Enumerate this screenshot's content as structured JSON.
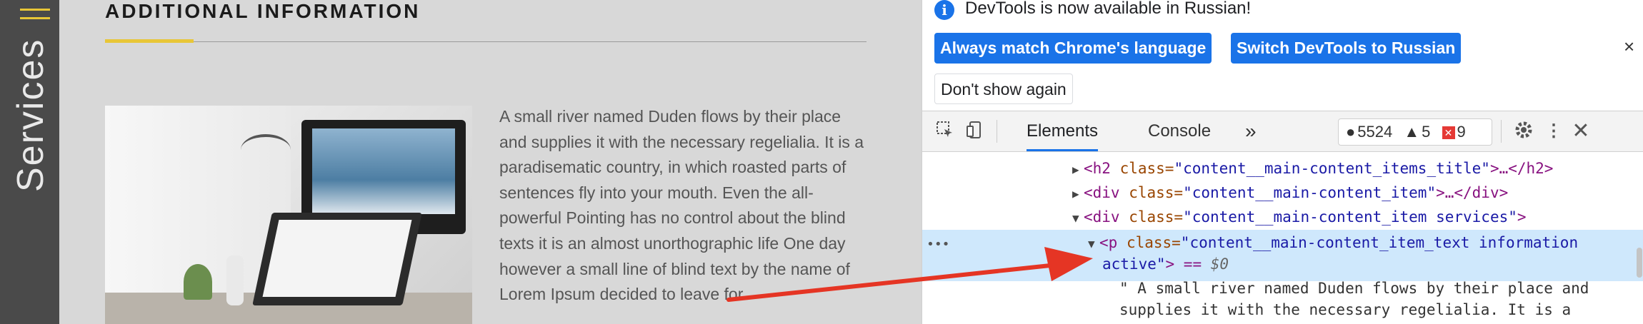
{
  "sidebar": {
    "vertical_label": "Services",
    "menu_icon": "hamburger-icon"
  },
  "page": {
    "heading": "ADDITIONAL INFORMATION",
    "photo_alt": "workspace-photo",
    "body_text": "A small river named Duden flows by their place and supplies it with the necessary regelialia. It is a paradisematic country, in which roasted parts of sentences fly into your mouth. Even the all-powerful Pointing has no control about the blind texts it is an almost unorthographic life One day however a small line of blind text by the name of Lorem Ipsum decided to leave for",
    "accent_color": "#e8c637"
  },
  "devtools": {
    "infobar": {
      "message": "DevTools is now available in Russian!",
      "btn_match": "Always match Chrome's language",
      "btn_switch": "Switch DevTools to Russian",
      "btn_dont_show": "Don't show again",
      "close": "×"
    },
    "toolbar": {
      "tabs": [
        "Elements",
        "Console"
      ],
      "more": "»",
      "counter_messages": "5524",
      "counter_warnings": "5",
      "counter_errors": "9"
    },
    "dom": {
      "line1_tag_open": "<h2 ",
      "line1_attr": "class=",
      "line1_val": "\"content__main-content_items_title\"",
      "line1_rest": ">…</h2>",
      "line2_tag_open": "<div ",
      "line2_attr": "class=",
      "line2_val": "\"content__main-content_item\"",
      "line2_rest": ">…</div>",
      "line3_tag_open": "<div ",
      "line3_attr": "class=",
      "line3_val": "\"content__main-content_item services\"",
      "line3_rest": ">",
      "line4_tag_open": "<p ",
      "line4_attr": "class=",
      "line4_val": "\"content__main-content_item_text information",
      "line5_val": "active\"",
      "line5_rest": "> == ",
      "line5_ref": "$0",
      "line6": "\" A small river named Duden flows by their place and",
      "line7": "supplies it with the necessary regelialia. It is a",
      "ellipsis": "•••"
    },
    "accent_color": "#1a73e8"
  }
}
